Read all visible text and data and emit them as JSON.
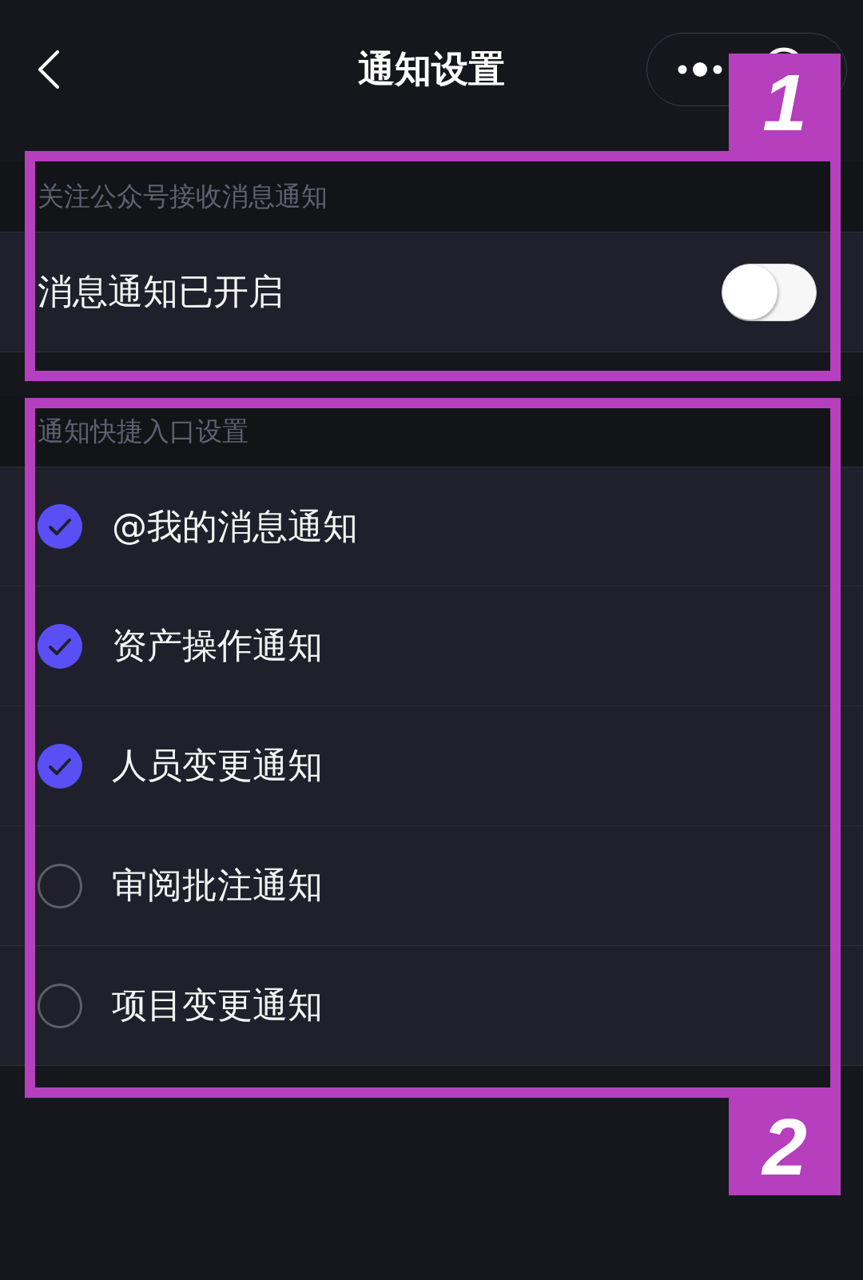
{
  "nav": {
    "title": "通知设置"
  },
  "sections": [
    {
      "header": "关注公众号接收消息通知",
      "annotation": "1",
      "items": [
        {
          "kind": "switch",
          "label": "消息通知已开启",
          "on": false
        }
      ]
    },
    {
      "header": "通知快捷入口设置",
      "annotation": "2",
      "items": [
        {
          "kind": "check",
          "label": "@我的消息通知",
          "checked": true
        },
        {
          "kind": "check",
          "label": "资产操作通知",
          "checked": true
        },
        {
          "kind": "check",
          "label": "人员变更通知",
          "checked": true
        },
        {
          "kind": "check",
          "label": "审阅批注通知",
          "checked": false
        },
        {
          "kind": "check",
          "label": "项目变更通知",
          "checked": false
        }
      ]
    }
  ]
}
